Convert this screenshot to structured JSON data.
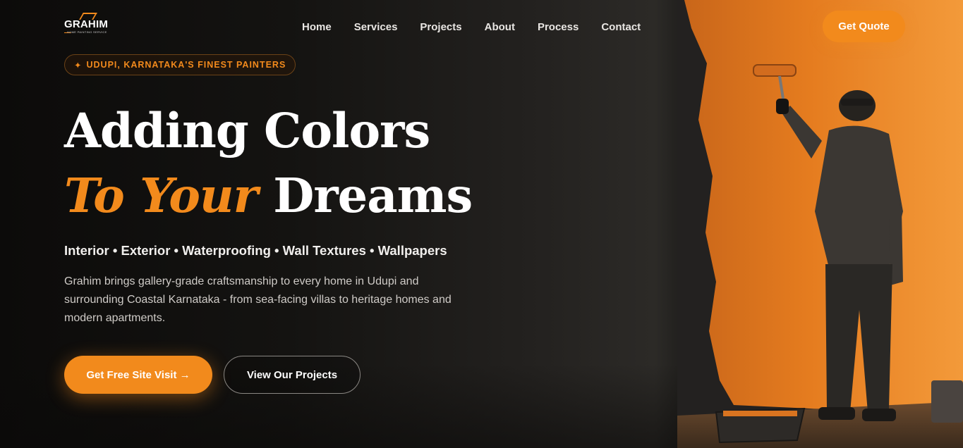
{
  "brand": {
    "name": "GRAHIM",
    "tagline": "HOME PAINTING SERVICE",
    "accent_color": "#f28a1c"
  },
  "nav": {
    "items": [
      {
        "label": "Home"
      },
      {
        "label": "Services"
      },
      {
        "label": "Projects"
      },
      {
        "label": "About"
      },
      {
        "label": "Process"
      },
      {
        "label": "Contact"
      }
    ],
    "cta_label": "Get Quote"
  },
  "hero": {
    "badge_icon": "sparkle-icon",
    "badge_glyph": "✦",
    "badge_text": "UDUPI, KARNATAKA'S FINEST PAINTERS",
    "title_line1": "Adding Colors",
    "title_accent": "To Your",
    "title_line2_rest": " Dreams",
    "services_line": "Interior • Exterior • Waterproofing • Wall Textures • Wallpapers",
    "description": "Grahim brings gallery-grade craftsmanship to every home in Udupi and surrounding Coastal Karnataka - from sea-facing villas to heritage homes and modern apartments.",
    "primary_button": "Get Free Site Visit →",
    "secondary_button": "View Our Projects"
  }
}
